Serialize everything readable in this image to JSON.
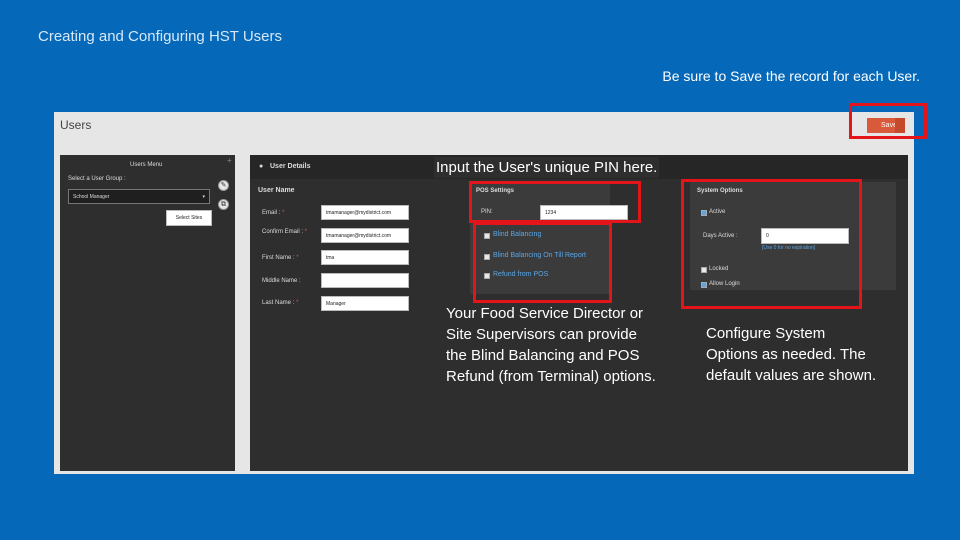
{
  "slide": {
    "title": "Creating and Configuring HST Users",
    "note": "Be sure to Save the record for each User."
  },
  "app": {
    "title": "Users",
    "save_label": "Save"
  },
  "users_menu": {
    "title": "Users Menu",
    "group_label": "Select a User Group :",
    "group_value": "School Manager",
    "select_sites_label": "Select Sites"
  },
  "user_details": {
    "title": "User Details",
    "section": "User Name",
    "fields": [
      {
        "label": "Email :",
        "value": "tmamanager@mydistrict.com"
      },
      {
        "label": "Confirm Email :",
        "value": "tmamanager@mydistrict.com"
      },
      {
        "label": "First Name :",
        "value": "tma"
      },
      {
        "label": "Middle Name :",
        "value": ""
      },
      {
        "label": "Last Name :",
        "value": "Manager"
      }
    ]
  },
  "pos_settings": {
    "title": "POS Settings",
    "pin_label": "PIN:",
    "pin_value": "1234",
    "options": [
      "Blind Balancing",
      "Blind Balancing On Till Report",
      "Refund from POS"
    ]
  },
  "system_options": {
    "title": "System Options",
    "active_label": "Active",
    "days_active_label": "Days Active :",
    "days_active_value": "0",
    "days_hint": "[Use 0 for no expiration]",
    "locked_label": "Locked",
    "allow_login_label": "Allow Login"
  },
  "callouts": {
    "pin": "Input the User's unique PIN here.",
    "pos": "Your Food Service Director or Site Supervisors can provide the Blind Balancing and POS Refund (from Terminal) options.",
    "system": "Configure System Options as needed. The default values are shown."
  },
  "colors": {
    "background": "#0668b8",
    "highlight": "#e3141a",
    "save_button": "#d95a3a"
  }
}
